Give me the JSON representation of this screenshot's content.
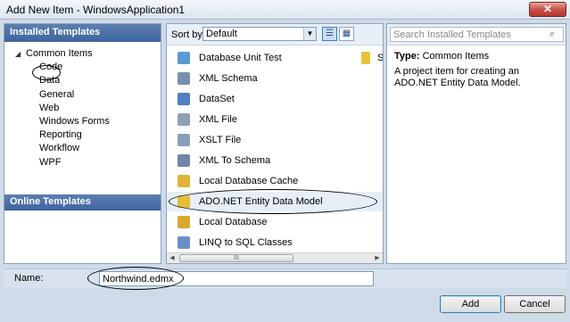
{
  "window": {
    "title": "Add New Item - WindowsApplication1",
    "close_glyph": "✕"
  },
  "left": {
    "header": "Installed Templates",
    "tree_root": "Common Items",
    "tree_children": [
      "Code",
      "Data",
      "General",
      "Web",
      "Windows Forms",
      "Reporting",
      "Workflow",
      "WPF"
    ],
    "selected": "Data",
    "online": "Online Templates"
  },
  "middle": {
    "sort_label": "Sort by:",
    "sort_value": "Default",
    "items": [
      {
        "label": "Database Unit Test",
        "icon": "unit-test-icon",
        "color": "#5a9bd5"
      },
      {
        "label": "XML Schema",
        "icon": "xml-schema-icon",
        "color": "#7a8fb0"
      },
      {
        "label": "DataSet",
        "icon": "dataset-icon",
        "color": "#4e7fc0"
      },
      {
        "label": "XML File",
        "icon": "xml-file-icon",
        "color": "#8f9fb7"
      },
      {
        "label": "XSLT File",
        "icon": "xslt-file-icon",
        "color": "#8aa0b8"
      },
      {
        "label": "XML To Schema",
        "icon": "xml-to-schema-icon",
        "color": "#6f86a8"
      },
      {
        "label": "Local Database Cache",
        "icon": "db-cache-icon",
        "color": "#e0b23a"
      },
      {
        "label": "ADO.NET Entity Data Model",
        "icon": "entity-model-icon",
        "color": "#e5bb3a"
      },
      {
        "label": "Local Database",
        "icon": "local-db-icon",
        "color": "#d7a82e"
      },
      {
        "label": "LINQ to SQL Classes",
        "icon": "linq-icon",
        "color": "#6a8ec9"
      }
    ],
    "selected_index": 7,
    "second_column_text": "Se",
    "scroll_thumb": "III"
  },
  "right": {
    "search_placeholder": "Search Installed Templates",
    "type_label": "Type:",
    "type_value": "Common Items",
    "description": "A project item for creating an ADO.NET Entity Data Model."
  },
  "bottom": {
    "name_label": "Name:",
    "name_value": "Northwind.edmx",
    "add": "Add",
    "cancel": "Cancel"
  }
}
